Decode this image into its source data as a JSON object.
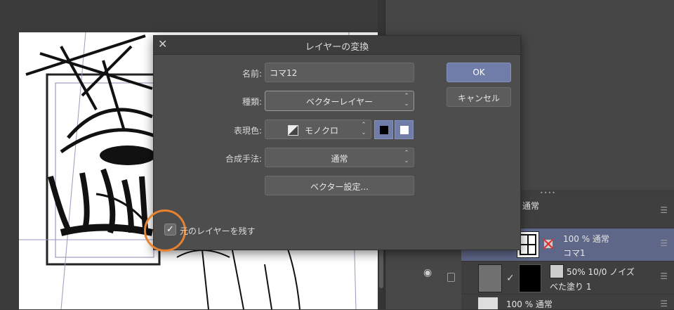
{
  "dialog": {
    "title": "レイヤーの変換",
    "fields": {
      "name_label": "名前:",
      "name_value": "コマ12",
      "type_label": "種類:",
      "type_value": "ベクターレイヤー",
      "color_label": "表現色:",
      "color_value": "モノクロ",
      "blend_label": "合成手法:",
      "blend_value": "通常"
    },
    "vector_settings_button": "ベクター設定...",
    "ok_button": "OK",
    "cancel_button": "キャンセル",
    "keep_original_label": "元のレイヤーを残す",
    "keep_original_checked": true,
    "accent_color": "#6f7da8",
    "highlight_color": "#e8822e"
  },
  "layers": {
    "top_row": {
      "blend": "通常"
    },
    "selected_row": {
      "opacity_blend": "100 % 通常",
      "name": "コマ1"
    },
    "fill_row": {
      "opacity_blend": "50% 10/0 ノイズ",
      "name": "べた塗り 1"
    },
    "bottom_row": {
      "opacity_blend": "100 % 通常"
    }
  }
}
